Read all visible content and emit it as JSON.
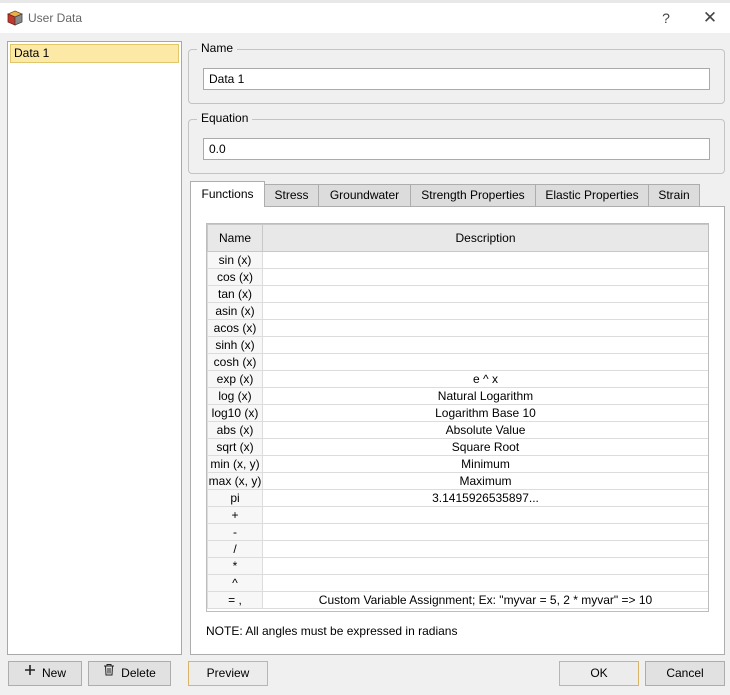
{
  "window": {
    "title": "User Data",
    "help_glyph": "?",
    "close_glyph": "✕",
    "app_icon": "cube-icon"
  },
  "left_panel": {
    "items": [
      {
        "label": "Data 1",
        "selected": true
      }
    ]
  },
  "name_group": {
    "label": "Name",
    "value": "Data 1"
  },
  "equation_group": {
    "label": "Equation",
    "value": "0.0"
  },
  "tabs": [
    {
      "label": "Functions",
      "active": true
    },
    {
      "label": "Stress",
      "active": false
    },
    {
      "label": "Groundwater",
      "active": false
    },
    {
      "label": "Strength Properties",
      "active": false
    },
    {
      "label": "Elastic Properties",
      "active": false
    },
    {
      "label": "Strain",
      "active": false
    }
  ],
  "functions_table": {
    "columns": [
      "Name",
      "Description"
    ],
    "rows": [
      {
        "name": "sin (x)",
        "description": ""
      },
      {
        "name": "cos (x)",
        "description": ""
      },
      {
        "name": "tan (x)",
        "description": ""
      },
      {
        "name": "asin (x)",
        "description": ""
      },
      {
        "name": "acos (x)",
        "description": ""
      },
      {
        "name": "sinh (x)",
        "description": ""
      },
      {
        "name": "cosh (x)",
        "description": ""
      },
      {
        "name": "exp (x)",
        "description": "e ^ x"
      },
      {
        "name": "log (x)",
        "description": "Natural Logarithm"
      },
      {
        "name": "log10 (x)",
        "description": "Logarithm Base 10"
      },
      {
        "name": "abs (x)",
        "description": "Absolute Value"
      },
      {
        "name": "sqrt (x)",
        "description": "Square Root"
      },
      {
        "name": "min (x, y)",
        "description": "Minimum"
      },
      {
        "name": "max (x, y)",
        "description": "Maximum"
      },
      {
        "name": "pi",
        "description": "3.1415926535897..."
      },
      {
        "name": "+",
        "description": ""
      },
      {
        "name": "-",
        "description": ""
      },
      {
        "name": "/",
        "description": ""
      },
      {
        "name": "*",
        "description": ""
      },
      {
        "name": "^",
        "description": ""
      },
      {
        "name": "= ,",
        "description": "Custom Variable Assignment; Ex: \"myvar = 5, 2 * myvar\" => 10"
      }
    ]
  },
  "note": "NOTE: All angles must be expressed in radians",
  "buttons": {
    "new": {
      "label": "New",
      "icon": "plus-icon"
    },
    "delete": {
      "label": "Delete",
      "icon": "trash-icon"
    },
    "preview": {
      "label": "Preview"
    },
    "ok": {
      "label": "OK"
    },
    "cancel": {
      "label": "Cancel"
    }
  }
}
